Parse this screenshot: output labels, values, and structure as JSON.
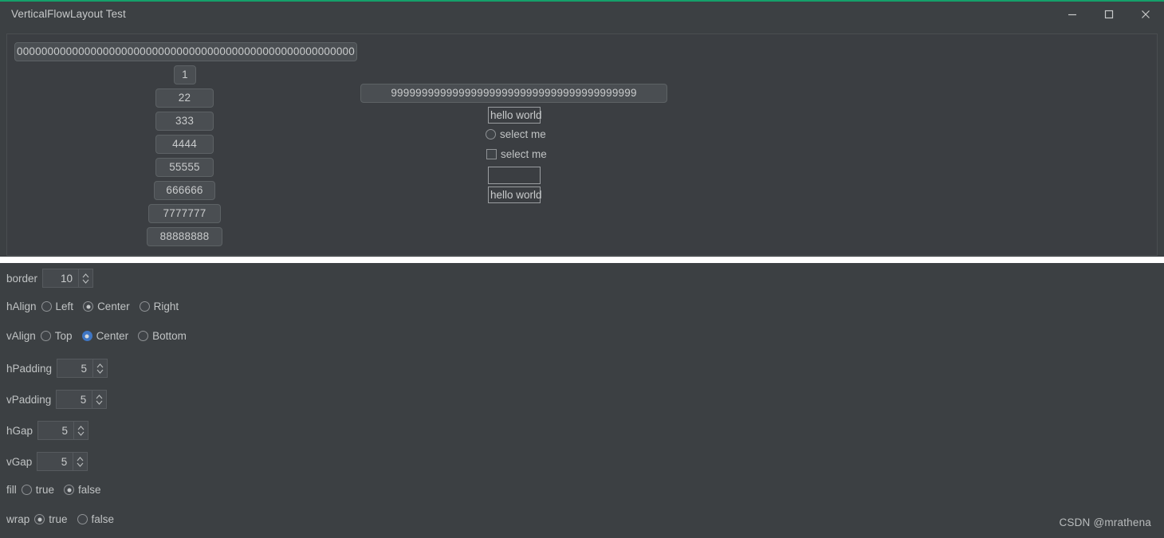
{
  "window": {
    "title": "VerticalFlowLayout Test",
    "accent_color": "#15a06a",
    "background_color": "#3c4043",
    "controls": [
      {
        "name": "minimize",
        "label": "Minimize"
      },
      {
        "name": "maximize",
        "label": "Maximize"
      },
      {
        "name": "close",
        "label": "Close"
      }
    ]
  },
  "preview": {
    "column_left": {
      "wide_button": "0000000000000000000000000000000000000000000000000000000",
      "buttons": [
        "1",
        "22",
        "333",
        "4444",
        "55555",
        "666666",
        "7777777",
        "88888888"
      ]
    },
    "column_right": {
      "wide_button": "9999999999999999999999999999999999999999",
      "textfield_1": "hello world",
      "radio_label": "select me",
      "radio_selected": false,
      "checkbox_label": "select me",
      "checkbox_checked": false,
      "textfield_empty": "",
      "textfield_2": "hello world"
    }
  },
  "controls": {
    "border": {
      "label": "border",
      "value": "10"
    },
    "hAlign": {
      "label": "hAlign",
      "options": [
        "Left",
        "Center",
        "Right"
      ],
      "selected": "Center",
      "focused": false
    },
    "vAlign": {
      "label": "vAlign",
      "options": [
        "Top",
        "Center",
        "Bottom"
      ],
      "selected": "Center",
      "focused": true,
      "focus_color": "#3f76c4"
    },
    "hPadding": {
      "label": "hPadding",
      "value": "5"
    },
    "vPadding": {
      "label": "vPadding",
      "value": "5"
    },
    "hGap": {
      "label": "hGap",
      "value": "5"
    },
    "vGap": {
      "label": "vGap",
      "value": "5"
    },
    "fill": {
      "label": "fill",
      "options": [
        "true",
        "false"
      ],
      "selected": "false"
    },
    "wrap": {
      "label": "wrap",
      "options": [
        "true",
        "false"
      ],
      "selected": "true"
    }
  },
  "watermark": "CSDN @mrathena"
}
